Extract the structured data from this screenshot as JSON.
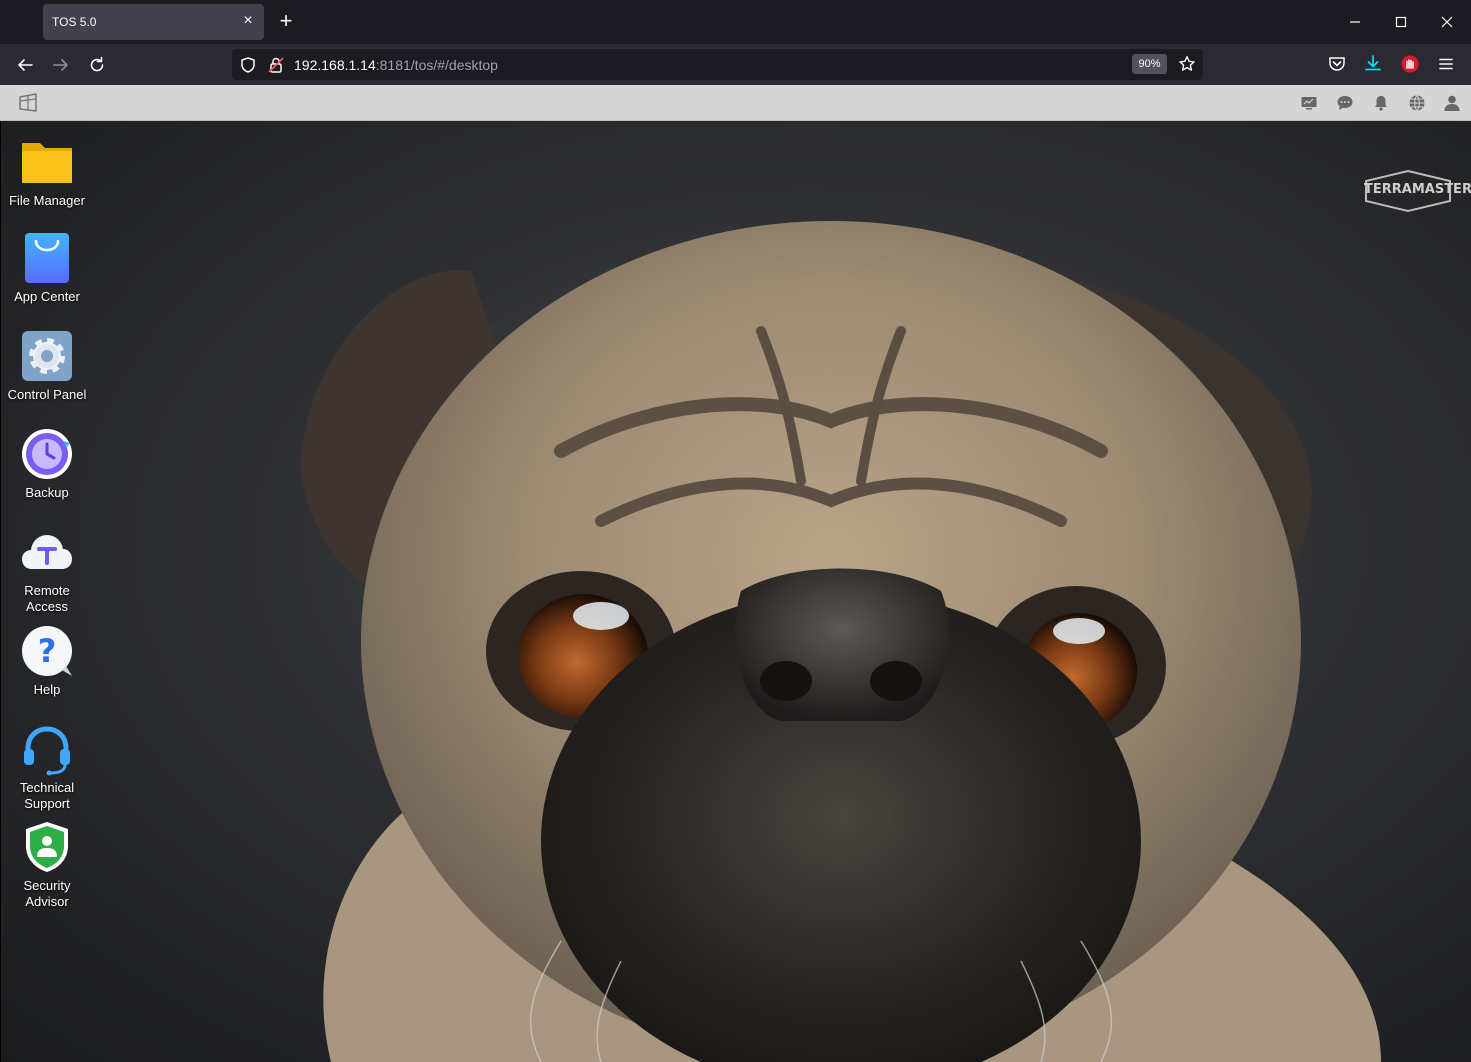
{
  "browser": {
    "tab_title": "TOS 5.0",
    "url_host": "192.168.1.14",
    "url_rest": ":8181/tos/#/desktop",
    "zoom": "90%"
  },
  "desktop": {
    "brand": "TERRAMASTER",
    "apps": [
      {
        "label": "File Manager",
        "icon": "folder-icon"
      },
      {
        "label": "App Center",
        "icon": "shopping-bag-icon"
      },
      {
        "label": "Control Panel",
        "icon": "gear-icon"
      },
      {
        "label": "Backup",
        "icon": "clock-icon"
      },
      {
        "label": "Remote\nAccess",
        "icon": "cloud-icon"
      },
      {
        "label": "Help",
        "icon": "question-icon"
      },
      {
        "label": "Technical\nSupport",
        "icon": "headset-icon"
      },
      {
        "label": "Security\nAdvisor",
        "icon": "shield-icon"
      }
    ]
  },
  "colors": {
    "folder": "#f9c11a",
    "app_center": "#3d8bff",
    "firefox_accent": "#00ddff"
  }
}
